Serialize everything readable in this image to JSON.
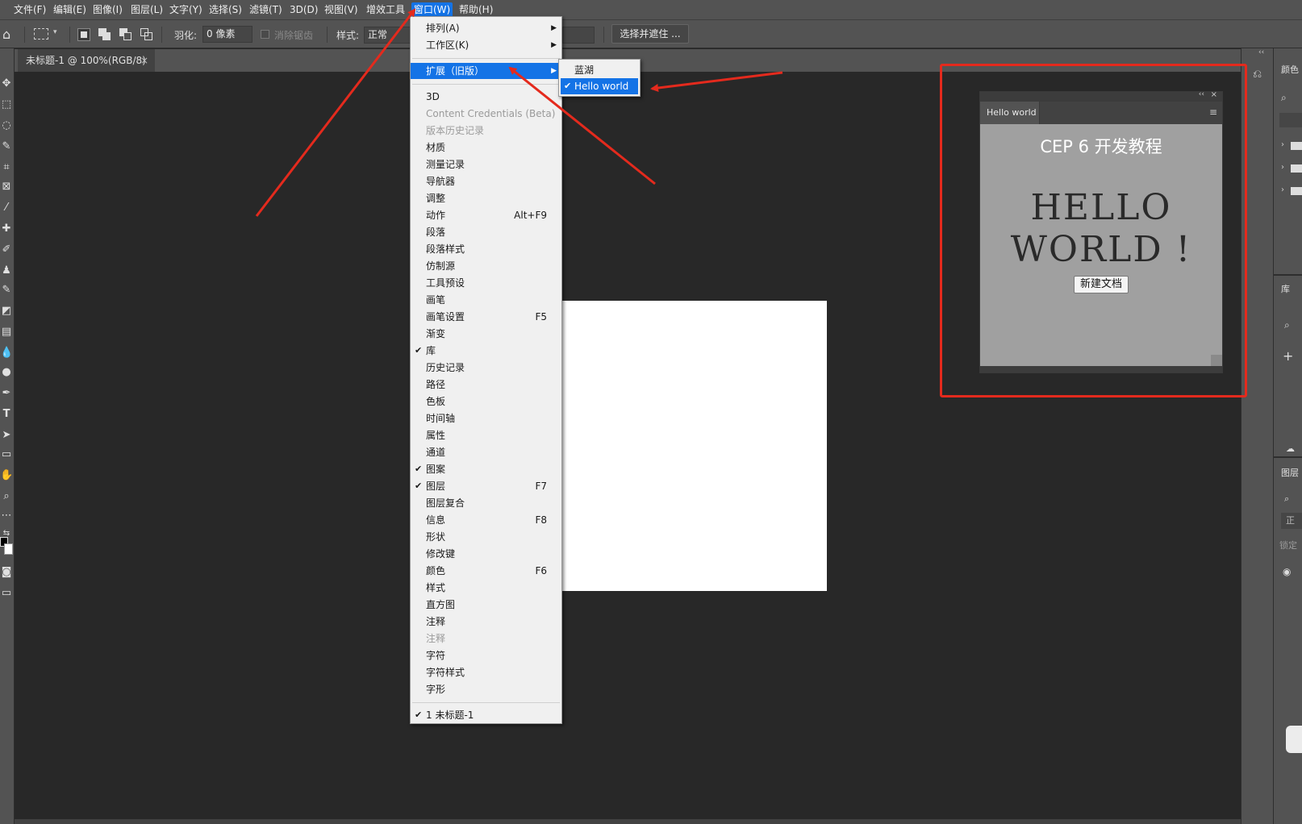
{
  "menubar": {
    "items": [
      "文件(F)",
      "编辑(E)",
      "图像(I)",
      "图层(L)",
      "文字(Y)",
      "选择(S)",
      "滤镜(T)",
      "3D(D)",
      "视图(V)",
      "增效工具",
      "窗口(W)",
      "帮助(H)"
    ],
    "active": "窗口(W)"
  },
  "options": {
    "feather_label": "羽化:",
    "feather_value": "0 像素",
    "antialias_label": "消除锯齿",
    "style_label": "样式:",
    "style_value": "正常",
    "select_mask_button": "选择并遮住 ..."
  },
  "document": {
    "tab_title": "未标题-1 @ 100%(RGB/8)",
    "tab_close": "×"
  },
  "window_menu": {
    "items": [
      {
        "label": "排列(A)",
        "submenu": true
      },
      {
        "label": "工作区(K)",
        "submenu": true
      },
      {
        "label": "扩展（旧版）",
        "submenu": true,
        "highlighted": true
      },
      {
        "label": "3D"
      },
      {
        "label": "Content Credentials (Beta)",
        "disabled": true
      },
      {
        "label": "版本历史记录",
        "disabled": true
      },
      {
        "label": "材质"
      },
      {
        "label": "测量记录"
      },
      {
        "label": "导航器"
      },
      {
        "label": "调整"
      },
      {
        "label": "动作",
        "shortcut": "Alt+F9"
      },
      {
        "label": "段落"
      },
      {
        "label": "段落样式"
      },
      {
        "label": "仿制源"
      },
      {
        "label": "工具预设"
      },
      {
        "label": "画笔"
      },
      {
        "label": "画笔设置",
        "shortcut": "F5"
      },
      {
        "label": "渐变"
      },
      {
        "label": "库",
        "checked": true
      },
      {
        "label": "历史记录"
      },
      {
        "label": "路径"
      },
      {
        "label": "色板"
      },
      {
        "label": "时间轴"
      },
      {
        "label": "属性"
      },
      {
        "label": "通道"
      },
      {
        "label": "图案",
        "checked": true
      },
      {
        "label": "图层",
        "checked": true,
        "shortcut": "F7"
      },
      {
        "label": "图层复合"
      },
      {
        "label": "信息",
        "shortcut": "F8"
      },
      {
        "label": "形状"
      },
      {
        "label": "修改键"
      },
      {
        "label": "颜色",
        "shortcut": "F6"
      },
      {
        "label": "样式"
      },
      {
        "label": "直方图"
      },
      {
        "label": "注释"
      },
      {
        "label": "注释",
        "disabled": true
      },
      {
        "label": "字符"
      },
      {
        "label": "字符样式"
      },
      {
        "label": "字形"
      },
      {
        "label": "1 未标题-1",
        "checked": true
      }
    ],
    "check_mark": "✔",
    "submenu_arrow": "▶"
  },
  "extensions_submenu": {
    "items": [
      {
        "label": "蓝湖"
      },
      {
        "label": "Hello world",
        "checked": true,
        "highlighted": true
      }
    ]
  },
  "cep_panel": {
    "tab_label": "Hello world",
    "heading": "CEP 6 开发教程",
    "hello_line1": "HELLO",
    "hello_line2": "WORLD !",
    "button_label": "新建文档",
    "collapse_glyph": "‹‹",
    "close_glyph": "×",
    "menu_glyph": "≡"
  },
  "right_dock": {
    "color_label": "颜色",
    "library_label": "库",
    "layers_label": "图层",
    "layers_blend": "正常",
    "lock_label": "锁定",
    "collapse_glyph": "‹‹"
  },
  "colors": {
    "accent": "#1473e6",
    "highlight_red": "#e42a1d",
    "ui_gray": "#535353",
    "canvas_dark": "#282828"
  }
}
